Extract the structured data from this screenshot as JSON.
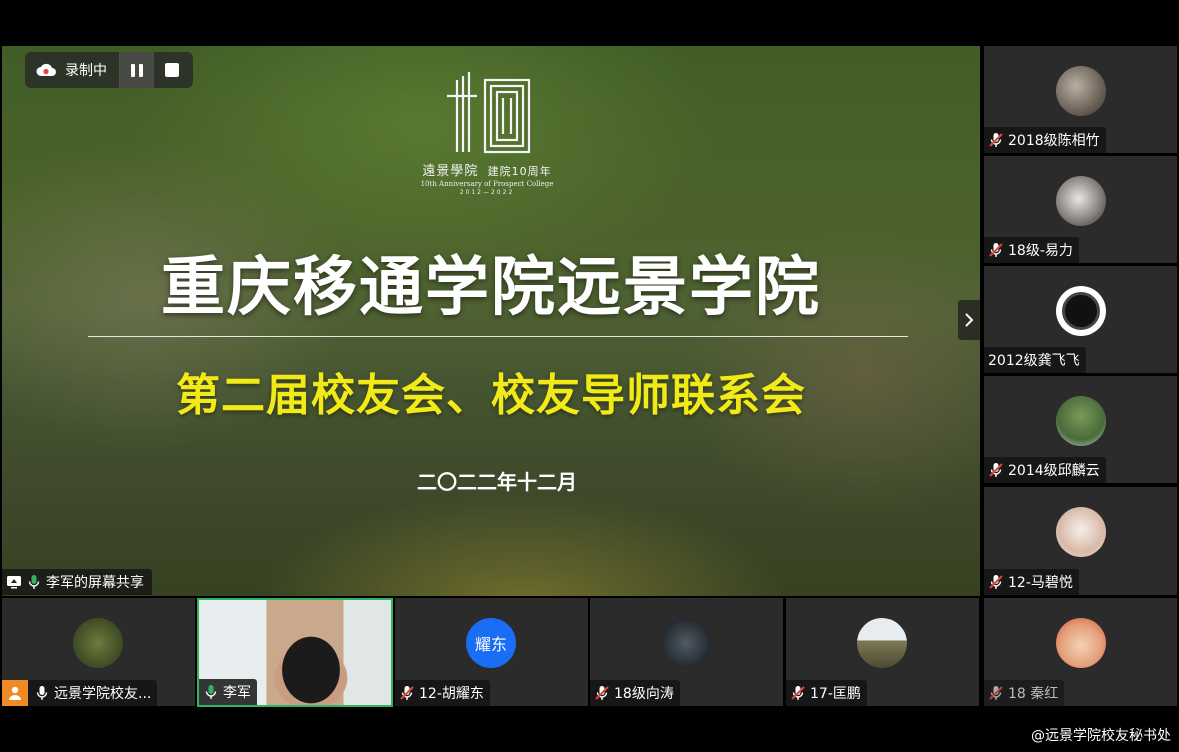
{
  "recording": {
    "label": "录制中"
  },
  "slide": {
    "logo_school": "遠景學院",
    "logo_anniv": "建院10周年",
    "logo_english": "10th Anniversary of Prospect College",
    "logo_years": "2012—2022",
    "title": "重庆移通学院远景学院",
    "subtitle": "第二届校友会、校友导师联系会",
    "date": "二〇二二年十二月"
  },
  "share_label": "李军的屏幕共享",
  "sidebar_participants": [
    {
      "name": "2018级陈相竹",
      "muted": true
    },
    {
      "name": "18级-易力",
      "muted": true
    },
    {
      "name": "2012级龚飞飞",
      "muted": false
    },
    {
      "name": "2014级邱麟云",
      "muted": true
    },
    {
      "name": "12-马碧悦",
      "muted": true
    }
  ],
  "bottom_participants": [
    {
      "name": "远景学院校友...",
      "muted": false
    },
    {
      "name": "李军",
      "muted": false,
      "speaking": true
    },
    {
      "name": "12-胡耀东",
      "muted": true,
      "avatar_text": "耀东"
    },
    {
      "name": "18级向涛",
      "muted": true
    },
    {
      "name": "17-匡鹏",
      "muted": true
    },
    {
      "name": "18 秦红",
      "muted": true
    }
  ],
  "watermark": "@远景学院校友秘书处",
  "colors": {
    "accent_green": "#2fb560",
    "mute_red": "#e0443e",
    "subtitle_yellow": "#f2ea16",
    "avatar_blue": "#1a6ef5"
  }
}
